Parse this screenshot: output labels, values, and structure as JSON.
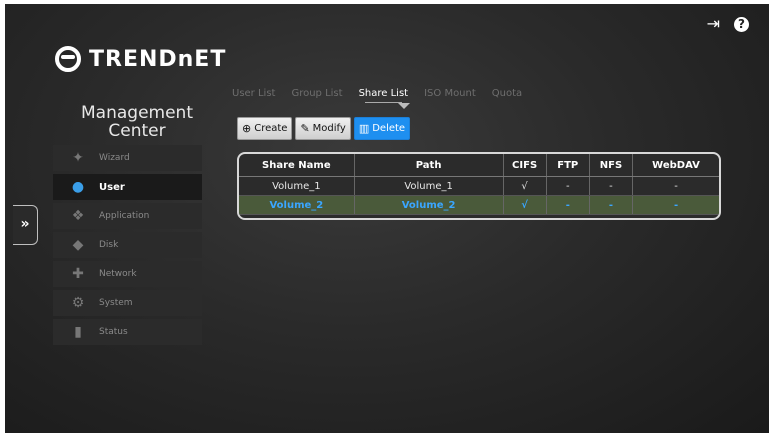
{
  "logo": {
    "text": "TRENDnET"
  },
  "sidebar": {
    "title_line1": "Management",
    "title_line2": "Center",
    "items": [
      {
        "label": "Wizard",
        "icon": "wizard-icon"
      },
      {
        "label": "User",
        "icon": "user-icon",
        "active": true
      },
      {
        "label": "Application",
        "icon": "application-icon"
      },
      {
        "label": "Disk",
        "icon": "disk-icon"
      },
      {
        "label": "Network",
        "icon": "network-icon"
      },
      {
        "label": "System",
        "icon": "system-icon"
      },
      {
        "label": "Status",
        "icon": "status-icon"
      }
    ],
    "expander_label": "»"
  },
  "tabs": [
    {
      "label": "User List"
    },
    {
      "label": "Group List"
    },
    {
      "label": "Share List",
      "active": true
    },
    {
      "label": "ISO Mount"
    },
    {
      "label": "Quota"
    }
  ],
  "toolbar": {
    "create_label": "Create",
    "modify_label": "Modify",
    "delete_label": "Delete"
  },
  "table": {
    "headers": [
      "Share Name",
      "Path",
      "CIFS",
      "FTP",
      "NFS",
      "WebDAV"
    ],
    "rows": [
      [
        "Volume_1",
        "Volume_1",
        "√",
        "-",
        "-",
        "-"
      ],
      [
        "Volume_2",
        "Volume_2",
        "√",
        "-",
        "-",
        "-"
      ]
    ],
    "selected_row": 1
  },
  "colors": {
    "accent": "#1e8ff0",
    "selected_row_bg": "#4a5a3a"
  }
}
